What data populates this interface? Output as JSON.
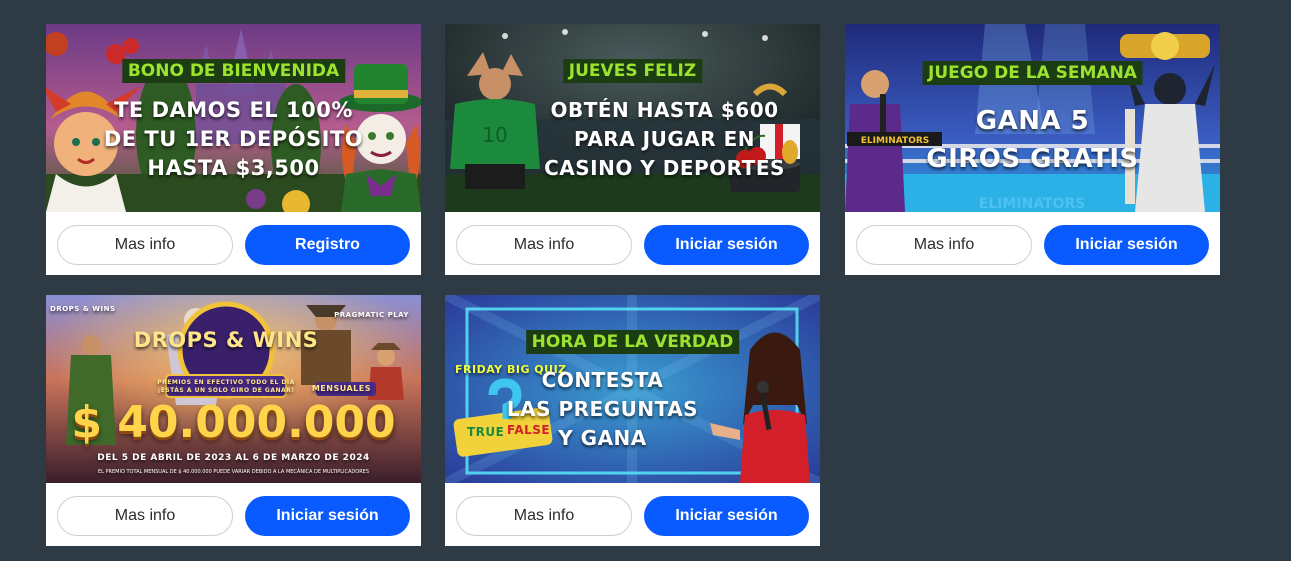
{
  "cards": [
    {
      "tag": "BONO DE BIENVENIDA",
      "lines": [
        "TE DAMOS EL 100%",
        "DE TU 1ER DEPÓSITO",
        "HASTA $3,500"
      ],
      "info_label": "Mas info",
      "cta_label": "Registro"
    },
    {
      "tag": "JUEVES FELIZ",
      "lines": [
        "OBTÉN HASTA $600",
        "PARA JUGAR EN",
        "CASINO Y DEPORTES"
      ],
      "player_number": "10",
      "info_label": "Mas info",
      "cta_label": "Iniciar sesión"
    },
    {
      "tag": "JUEGO DE LA SEMANA",
      "lines": [
        "GANA 5",
        "GIROS GRATIS"
      ],
      "sign": "ELIMINATORS",
      "floor_text": "ELIMINATORS",
      "info_label": "Mas info",
      "cta_label": "Iniciar sesión"
    },
    {
      "logo": "DROPS & WINS",
      "corner_logo": "DROPS & WINS",
      "brand": "PRAGMATIC PLAY",
      "ribbon_line1": "PREMIOS EN EFECTIVO TODO EL DÍA",
      "ribbon_line2": "¡ESTÁS A UN SOLO GIRO DE GANAR!",
      "mensuales": "MENSUALES",
      "amount": "$ 40.000.000",
      "dates": "DEL 5 DE ABRIL DE 2023 AL 6 DE MARZO DE 2024",
      "disclaimer": "EL PREMIO TOTAL MENSUAL DE $ 40.000.000 PUEDE VARIAR DEBIDO A LA MECÁNICA DE MULTIPLICADORES",
      "info_label": "Mas info",
      "cta_label": "Iniciar sesión"
    },
    {
      "tag": "HORA DE LA VERDAD",
      "quiz_label": "FRIDAY BIG QUIZ",
      "quiz_true": "TRUE",
      "quiz_false": "FALSE",
      "lines": [
        "CONTESTA",
        "LAS PREGUNTAS",
        "Y GANA"
      ],
      "info_label": "Mas info",
      "cta_label": "Iniciar sesión"
    }
  ],
  "colors": {
    "page_bg": "#2f3b44",
    "cta_blue": "#0a5bff",
    "tag_green": "#9be32e"
  }
}
